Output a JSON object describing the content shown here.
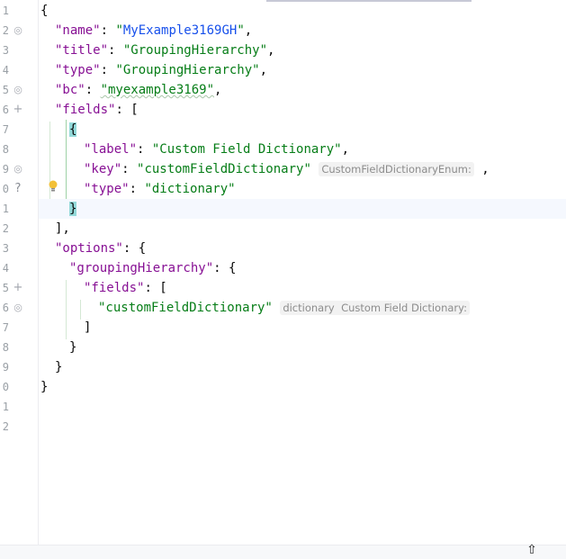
{
  "editor": {
    "line_numbers": [
      "1",
      "2",
      "3",
      "4",
      "5",
      "6",
      "7",
      "8",
      "9",
      "0",
      "1",
      "2",
      "3",
      "4",
      "5",
      "6",
      "7",
      "8",
      "9",
      "0",
      "1",
      "2"
    ],
    "gutter_icons": {
      "l2": "◎",
      "l5": "◎",
      "l6": "+",
      "l9": "◎",
      "l10": "?",
      "l15": "+",
      "l16": "◎"
    },
    "code": {
      "l1": "{",
      "l2": {
        "key": "\"name\"",
        "colon": ": ",
        "value": "\"MyExample3169GH\"",
        "tail": ","
      },
      "l3": {
        "key": "\"title\"",
        "colon": ": ",
        "value": "\"GroupingHierarchy\"",
        "tail": ","
      },
      "l4": {
        "key": "\"type\"",
        "colon": ": ",
        "value": "\"GroupingHierarchy\"",
        "tail": ","
      },
      "l5": {
        "key": "\"bc\"",
        "colon": ": ",
        "value": "\"myexample3169\"",
        "tail": ","
      },
      "l6": {
        "key": "\"fields\"",
        "colon": ": ",
        "tail": "["
      },
      "l7": "{",
      "l8": {
        "key": "\"label\"",
        "colon": ": ",
        "value": "\"Custom Field Dictionary\"",
        "tail": ","
      },
      "l9": {
        "key": "\"key\"",
        "colon": ": ",
        "value": "\"customFieldDictionary\"",
        "hint": "CustomFieldDictionaryEnum:",
        "tail": ","
      },
      "l10": {
        "key": "\"type\"",
        "colon": ": ",
        "value": "\"dictionary\""
      },
      "l11": "}",
      "l12": "],",
      "l13": {
        "key": "\"options\"",
        "colon": ": ",
        "tail": "{"
      },
      "l14": {
        "key": "\"groupingHierarchy\"",
        "colon": ": ",
        "tail": "{"
      },
      "l15": {
        "key": "\"fields\"",
        "colon": ": ",
        "tail": "["
      },
      "l16": {
        "value": "\"customFieldDictionary\"",
        "hint1": "dictionary",
        "hint2": "Custom Field Dictionary:"
      },
      "l17": "]",
      "l18": "}",
      "l19": "}",
      "l20": "}"
    },
    "status_icon": "⇧"
  },
  "colors": {
    "key": "#871094",
    "string": "#067d17",
    "string_link": "#1750eb",
    "brace_match": "#93d9d9",
    "current_line": "#f5f8fe"
  }
}
